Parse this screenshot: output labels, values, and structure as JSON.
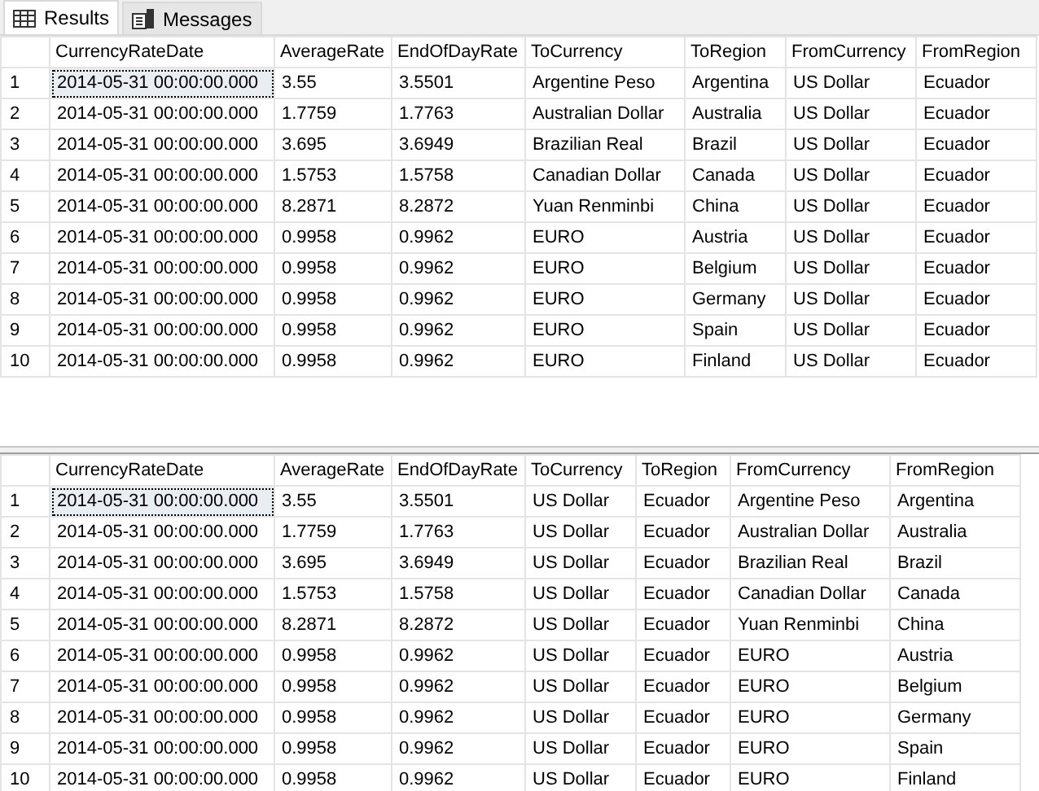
{
  "tabs": [
    {
      "label": "Results",
      "kind": "grid",
      "selected": true
    },
    {
      "label": "Messages",
      "kind": "messages",
      "selected": false
    }
  ],
  "grids": [
    {
      "columns": [
        "CurrencyRateDate",
        "AverageRate",
        "EndOfDayRate",
        "ToCurrency",
        "ToRegion",
        "FromCurrency",
        "FromRegion"
      ],
      "rows": [
        {
          "number": "1",
          "selected": true,
          "cells": [
            "2014-05-31 00:00:00.000",
            "3.55",
            "3.5501",
            "Argentine Peso",
            "Argentina",
            "US Dollar",
            "Ecuador"
          ]
        },
        {
          "number": "2",
          "selected": false,
          "cells": [
            "2014-05-31 00:00:00.000",
            "1.7759",
            "1.7763",
            "Australian Dollar",
            "Australia",
            "US Dollar",
            "Ecuador"
          ]
        },
        {
          "number": "3",
          "selected": false,
          "cells": [
            "2014-05-31 00:00:00.000",
            "3.695",
            "3.6949",
            "Brazilian Real",
            "Brazil",
            "US Dollar",
            "Ecuador"
          ]
        },
        {
          "number": "4",
          "selected": false,
          "cells": [
            "2014-05-31 00:00:00.000",
            "1.5753",
            "1.5758",
            "Canadian Dollar",
            "Canada",
            "US Dollar",
            "Ecuador"
          ]
        },
        {
          "number": "5",
          "selected": false,
          "cells": [
            "2014-05-31 00:00:00.000",
            "8.2871",
            "8.2872",
            "Yuan Renminbi",
            "China",
            "US Dollar",
            "Ecuador"
          ]
        },
        {
          "number": "6",
          "selected": false,
          "cells": [
            "2014-05-31 00:00:00.000",
            "0.9958",
            "0.9962",
            "EURO",
            "Austria",
            "US Dollar",
            "Ecuador"
          ]
        },
        {
          "number": "7",
          "selected": false,
          "cells": [
            "2014-05-31 00:00:00.000",
            "0.9958",
            "0.9962",
            "EURO",
            "Belgium",
            "US Dollar",
            "Ecuador"
          ]
        },
        {
          "number": "8",
          "selected": false,
          "cells": [
            "2014-05-31 00:00:00.000",
            "0.9958",
            "0.9962",
            "EURO",
            "Germany",
            "US Dollar",
            "Ecuador"
          ]
        },
        {
          "number": "9",
          "selected": false,
          "cells": [
            "2014-05-31 00:00:00.000",
            "0.9958",
            "0.9962",
            "EURO",
            "Spain",
            "US Dollar",
            "Ecuador"
          ]
        },
        {
          "number": "10",
          "selected": false,
          "cells": [
            "2014-05-31 00:00:00.000",
            "0.9958",
            "0.9962",
            "EURO",
            "Finland",
            "US Dollar",
            "Ecuador"
          ]
        }
      ]
    },
    {
      "columns": [
        "CurrencyRateDate",
        "AverageRate",
        "EndOfDayRate",
        "ToCurrency",
        "ToRegion",
        "FromCurrency",
        "FromRegion"
      ],
      "rows": [
        {
          "number": "1",
          "selected": true,
          "cells": [
            "2014-05-31 00:00:00.000",
            "3.55",
            "3.5501",
            "US Dollar",
            "Ecuador",
            "Argentine Peso",
            "Argentina"
          ]
        },
        {
          "number": "2",
          "selected": false,
          "cells": [
            "2014-05-31 00:00:00.000",
            "1.7759",
            "1.7763",
            "US Dollar",
            "Ecuador",
            "Australian Dollar",
            "Australia"
          ]
        },
        {
          "number": "3",
          "selected": false,
          "cells": [
            "2014-05-31 00:00:00.000",
            "3.695",
            "3.6949",
            "US Dollar",
            "Ecuador",
            "Brazilian Real",
            "Brazil"
          ]
        },
        {
          "number": "4",
          "selected": false,
          "cells": [
            "2014-05-31 00:00:00.000",
            "1.5753",
            "1.5758",
            "US Dollar",
            "Ecuador",
            "Canadian Dollar",
            "Canada"
          ]
        },
        {
          "number": "5",
          "selected": false,
          "cells": [
            "2014-05-31 00:00:00.000",
            "8.2871",
            "8.2872",
            "US Dollar",
            "Ecuador",
            "Yuan Renminbi",
            "China"
          ]
        },
        {
          "number": "6",
          "selected": false,
          "cells": [
            "2014-05-31 00:00:00.000",
            "0.9958",
            "0.9962",
            "US Dollar",
            "Ecuador",
            "EURO",
            "Austria"
          ]
        },
        {
          "number": "7",
          "selected": false,
          "cells": [
            "2014-05-31 00:00:00.000",
            "0.9958",
            "0.9962",
            "US Dollar",
            "Ecuador",
            "EURO",
            "Belgium"
          ]
        },
        {
          "number": "8",
          "selected": false,
          "cells": [
            "2014-05-31 00:00:00.000",
            "0.9958",
            "0.9962",
            "US Dollar",
            "Ecuador",
            "EURO",
            "Germany"
          ]
        },
        {
          "number": "9",
          "selected": false,
          "cells": [
            "2014-05-31 00:00:00.000",
            "0.9958",
            "0.9962",
            "US Dollar",
            "Ecuador",
            "EURO",
            "Spain"
          ]
        },
        {
          "number": "10",
          "selected": false,
          "cells": [
            "2014-05-31 00:00:00.000",
            "0.9958",
            "0.9962",
            "US Dollar",
            "Ecuador",
            "EURO",
            "Finland"
          ]
        }
      ]
    }
  ]
}
